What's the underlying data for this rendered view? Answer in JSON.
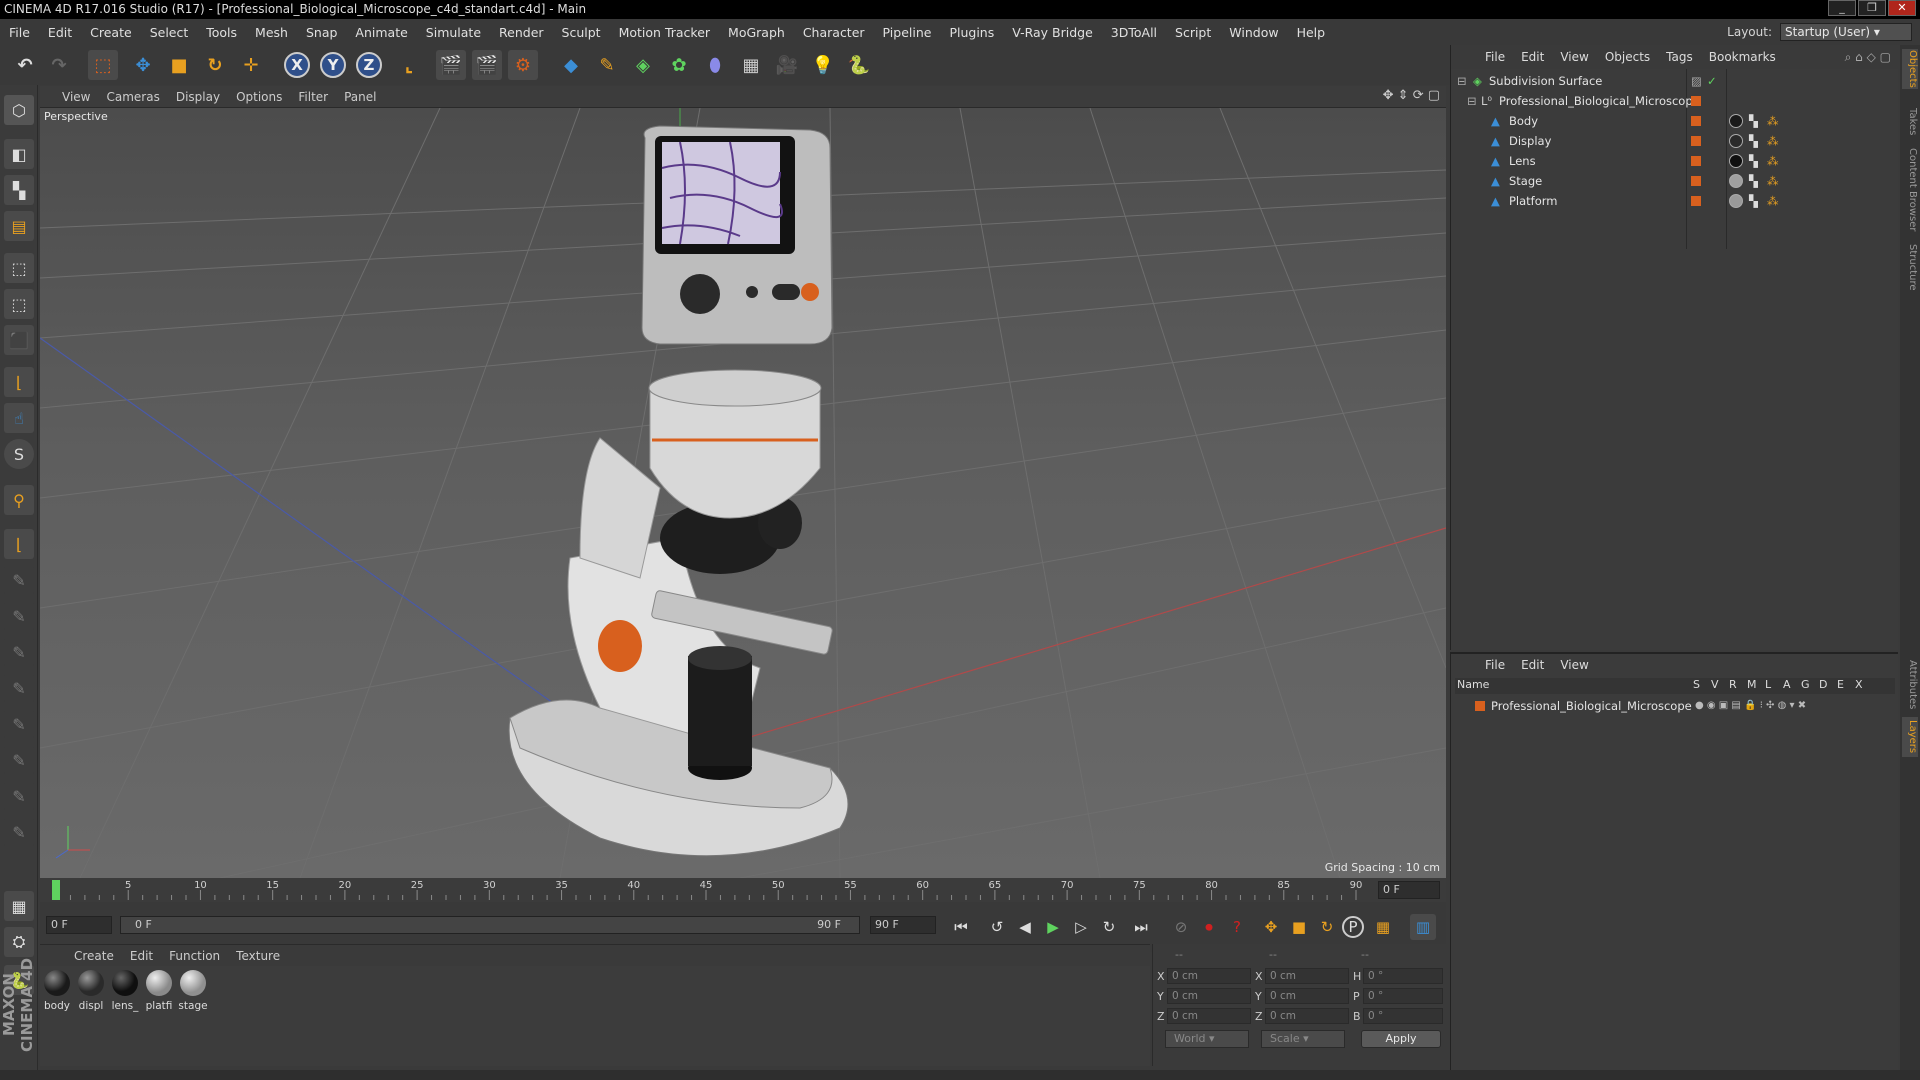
{
  "window": {
    "title": "CINEMA 4D R17.016 Studio (R17) - [Professional_Biological_Microscope_c4d_standart.c4d] - Main"
  },
  "menubar": [
    "File",
    "Edit",
    "Create",
    "Select",
    "Tools",
    "Mesh",
    "Snap",
    "Animate",
    "Simulate",
    "Render",
    "Sculpt",
    "Motion Tracker",
    "MoGraph",
    "Character",
    "Pipeline",
    "Plugins",
    "V-Ray Bridge",
    "3DToAll",
    "Script",
    "Window",
    "Help"
  ],
  "layout": {
    "label": "Layout:",
    "value": "Startup (User)"
  },
  "toolbar_axes": [
    "X",
    "Y",
    "Z"
  ],
  "viewport": {
    "menu": [
      "View",
      "Cameras",
      "Display",
      "Options",
      "Filter",
      "Panel"
    ],
    "label": "Perspective",
    "grid_spacing": "Grid Spacing : 10 cm"
  },
  "timeline": {
    "ticks": [
      "0",
      "5",
      "10",
      "15",
      "20",
      "25",
      "30",
      "35",
      "40",
      "45",
      "50",
      "55",
      "60",
      "65",
      "70",
      "75",
      "80",
      "85",
      "90"
    ],
    "current_frame": "0 F"
  },
  "transport": {
    "start_field": "0 F",
    "range_start": "0 F",
    "range_end": "90 F",
    "end_field": "90 F"
  },
  "materials": {
    "menu": [
      "Create",
      "Edit",
      "Function",
      "Texture"
    ],
    "items": [
      {
        "name": "body",
        "color": "#1a1a1a"
      },
      {
        "name": "displ",
        "color": "#2a2a2a"
      },
      {
        "name": "lens_",
        "color": "#0f0f0f"
      },
      {
        "name": "platfi",
        "color": "#9a9a9a"
      },
      {
        "name": "stage",
        "color": "#a0a0a0"
      }
    ]
  },
  "coordinates": {
    "headers": [
      "--",
      "--",
      "--"
    ],
    "rows": [
      {
        "a": "X",
        "av": "0 cm",
        "b": "X",
        "bv": "0 cm",
        "c": "H",
        "cv": "0 °"
      },
      {
        "a": "Y",
        "av": "0 cm",
        "b": "Y",
        "bv": "0 cm",
        "c": "P",
        "cv": "0 °"
      },
      {
        "a": "Z",
        "av": "0 cm",
        "b": "Z",
        "bv": "0 cm",
        "c": "B",
        "cv": "0 °"
      }
    ],
    "space": "World",
    "mode": "Scale",
    "apply": "Apply"
  },
  "objects": {
    "menu": [
      "File",
      "Edit",
      "View",
      "Objects",
      "Tags",
      "Bookmarks"
    ],
    "items": [
      {
        "name": "Subdivision Surface"
      },
      {
        "name": "Professional_Biological_Microscope"
      },
      {
        "name": "Body"
      },
      {
        "name": "Display"
      },
      {
        "name": "Lens"
      },
      {
        "name": "Stage"
      },
      {
        "name": "Platform"
      }
    ]
  },
  "layers": {
    "menu": [
      "File",
      "Edit",
      "View"
    ],
    "header_name": "Name",
    "columns": [
      "S",
      "V",
      "R",
      "M",
      "L",
      "A",
      "G",
      "D",
      "E",
      "X"
    ],
    "rows": [
      {
        "name": "Professional_Biological_Microscope"
      }
    ]
  },
  "right_tabs": [
    "Objects",
    "Takes",
    "Content Browser",
    "Structure",
    "Attributes",
    "Layers"
  ],
  "maxon_logo": "MAXON CINEMA 4D",
  "colors": {
    "accent_orange": "#d8601e",
    "accent_blue": "#3b8ed6",
    "active_green": "#5fd35f"
  }
}
